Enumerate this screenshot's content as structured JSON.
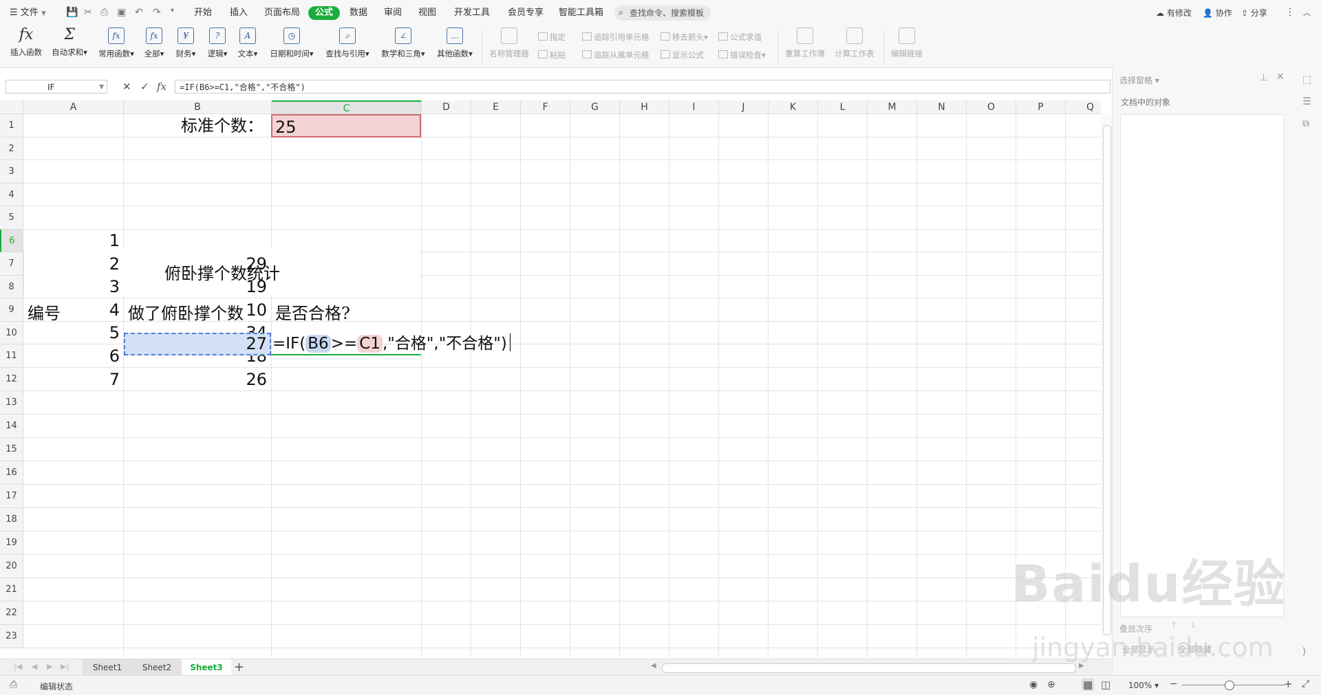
{
  "menu": {
    "file": "文件",
    "items": [
      "开始",
      "插入",
      "页面布局",
      "公式",
      "数据",
      "审阅",
      "视图",
      "开发工具",
      "会员专享",
      "智能工具箱"
    ],
    "active_index": 3,
    "search": "查找命令、搜索模板",
    "right": [
      "有修改",
      "协作",
      "分享"
    ]
  },
  "ribbon": {
    "buttons": [
      "插入函数",
      "自动求和",
      "常用函数",
      "全部",
      "财务",
      "逻辑",
      "文本",
      "日期和时间",
      "查找与引用",
      "数学和三角",
      "其他函数"
    ],
    "gray_big": [
      "名称管理器"
    ],
    "small": [
      "指定",
      "粘贴",
      "追踪引用单元格",
      "追踪从属单元格",
      "移去箭头",
      "显示公式",
      "公式求值",
      "错误检查"
    ],
    "gray_right": [
      "重算工作簿",
      "计算工作表",
      "编辑链接"
    ]
  },
  "formula_bar": {
    "name_box": "IF",
    "formula": "=IF(B6>=C1,\"合格\",\"不合格\")"
  },
  "grid": {
    "columns": [
      "A",
      "B",
      "C",
      "D",
      "E",
      "F",
      "G",
      "H",
      "I",
      "J",
      "K",
      "L",
      "M",
      "N",
      "O",
      "P",
      "Q"
    ],
    "rows": [
      "1",
      "2",
      "3",
      "4",
      "5",
      "6",
      "7",
      "8",
      "9",
      "10",
      "11",
      "12",
      "13",
      "14",
      "15",
      "16",
      "17",
      "18",
      "19",
      "20",
      "21",
      "22",
      "23"
    ],
    "b1_label": "标准个数：",
    "c1_value": "25",
    "title": "俯卧撑个数统计",
    "header_a": "编号",
    "header_b": "做了俯卧撑个数",
    "header_c": "是否合格?",
    "ids": [
      "1",
      "2",
      "3",
      "4",
      "5",
      "6",
      "7"
    ],
    "counts": [
      "27",
      "29",
      "19",
      "10",
      "34",
      "18",
      "26"
    ],
    "edit": {
      "part1": "=IF(",
      "ref1": "B6",
      "part2": ">=",
      "ref2": "C1",
      "part3": ",\"合格\",\"不合格\")"
    }
  },
  "sheets": [
    "Sheet1",
    "Sheet2",
    "Sheet3"
  ],
  "active_sheet": 2,
  "status": {
    "mode": "编辑状态",
    "zoom": "100%"
  },
  "pane": {
    "title": "选择窗格",
    "subtitle": "文档中的对象",
    "bottom_label": "叠放次序",
    "btn_show": "全部显示",
    "btn_hide": "全部隐藏"
  },
  "watermark": {
    "brand": "Baidu经验",
    "url": "jingyan.baidu.com"
  },
  "colors": {
    "accent": "#1aad3c",
    "ref_blue": "#c7d8f2",
    "ref_red": "#f3d3d3"
  }
}
